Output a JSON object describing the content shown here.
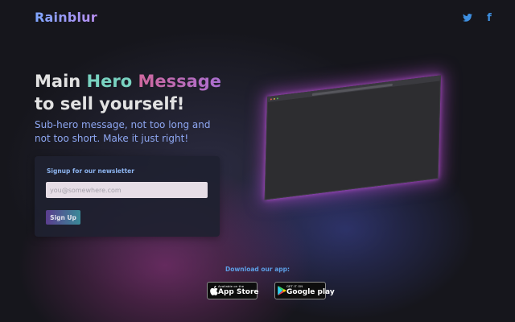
{
  "brand": {
    "name": "Rainblur"
  },
  "social": [
    {
      "name": "twitter",
      "icon": "twitter-icon",
      "color": "#3e8fe0"
    },
    {
      "name": "facebook",
      "icon": "facebook-icon",
      "glyph": "f",
      "color": "#3e8fe0"
    }
  ],
  "hero": {
    "line1_a": "Main ",
    "line1_b": "Hero",
    "line1_c": " Message",
    "line2": "to sell yourself!",
    "subtitle": "Sub-hero message, not too long and not too short. Make it just right!"
  },
  "newsletter": {
    "title": "Signup for our newsletter",
    "email_placeholder": "you@somewhere.com",
    "email_value": "",
    "button_label": "Sign Up"
  },
  "download": {
    "label": "Download our app:",
    "app_store": {
      "small": "Available on the",
      "big": "App Store",
      "icon": "apple-icon"
    },
    "google_play": {
      "small": "GET IT ON",
      "big": "Google play",
      "icon": "google-play-icon"
    }
  },
  "colors": {
    "background": "#16161c",
    "accent_teal": "#79d3c1",
    "accent_pink": "#d2689a",
    "subtitle_blue": "#8ea7f2",
    "button_gradient": [
      "#5b3d8e",
      "#3a8a98"
    ],
    "screen_glow": "#be50dc"
  }
}
